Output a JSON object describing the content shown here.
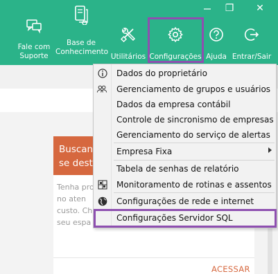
{
  "window": {
    "restore_glyph": "❐",
    "close_glyph": "✕"
  },
  "toolbar": {
    "items": [
      {
        "line1": "Fale com",
        "line2": "Suporte",
        "icon": "chat-icon"
      },
      {
        "line1": "Base de",
        "line2": "Conhecimento",
        "icon": "knowledge-base-icon"
      },
      {
        "line1": "Utilitários",
        "line2": "",
        "icon": "tools-icon"
      },
      {
        "line1": "Configurações",
        "line2": "",
        "icon": "gear-icon"
      },
      {
        "line1": "Ajuda",
        "line2": "",
        "icon": "help-icon"
      },
      {
        "line1": "Entrar/Sair",
        "line2": "",
        "icon": "logout-icon"
      }
    ]
  },
  "card": {
    "title_line1": "Buscand",
    "title_line2": "se desta",
    "body": [
      "Tenha pro",
      "no  aten",
      "custo. Ch",
      "seu espa"
    ],
    "action": "ACESSAR"
  },
  "menu": {
    "items": [
      {
        "label": "Dados do proprietário",
        "icon": "info-icon"
      },
      {
        "label": "Gerenciamento de grupos e usuários",
        "icon": "users-icon"
      },
      {
        "label": "Dados da empresa contábil",
        "icon": ""
      },
      {
        "label": "Controle de sincronismo de empresas",
        "icon": ""
      },
      {
        "label": "Gerenciamento do serviço de alertas",
        "icon": ""
      },
      {
        "label": "Empresa Fixa",
        "icon": "",
        "submenu": true
      },
      {
        "label": "Tabela de senhas de relatório",
        "icon": ""
      },
      {
        "label": "Monitoramento de rotinas e assentos",
        "icon": ""
      },
      {
        "label": "Configurações de rede e internet",
        "icon": "globe-icon"
      },
      {
        "label": "Configurações Servidor SQL",
        "icon": ""
      }
    ]
  },
  "colors": {
    "toolbar": "#2bb389",
    "highlight": "#8e4fb0",
    "card_header": "#d6683f"
  }
}
